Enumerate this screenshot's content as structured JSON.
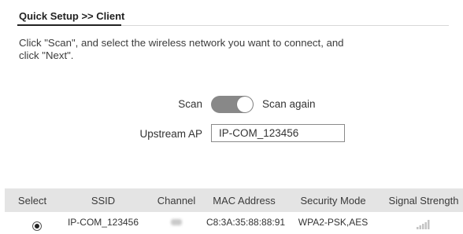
{
  "header": {
    "title": "Quick Setup >> Client"
  },
  "instruction": "Click \"Scan\", and select the wireless network you want to connect, and click \"Next\".",
  "scan": {
    "label": "Scan",
    "toggle_on": true,
    "again_label": "Scan again"
  },
  "upstream": {
    "label": "Upstream AP",
    "value": "IP-COM_123456"
  },
  "table": {
    "headers": [
      "Select",
      "SSID",
      "Channel",
      "MAC Address",
      "Security Mode",
      "Signal Strength"
    ],
    "rows": [
      {
        "selected": true,
        "ssid": "IP-COM_123456",
        "channel": "",
        "mac": "C8:3A:35:88:88:91",
        "security": "WPA2-PSK,AES",
        "signal_icon": "signal-strength-icon"
      }
    ]
  },
  "colors": {
    "toggle_track": "#888888",
    "table_header_bg": "#e4e4e4",
    "title_underline": "#222222"
  }
}
